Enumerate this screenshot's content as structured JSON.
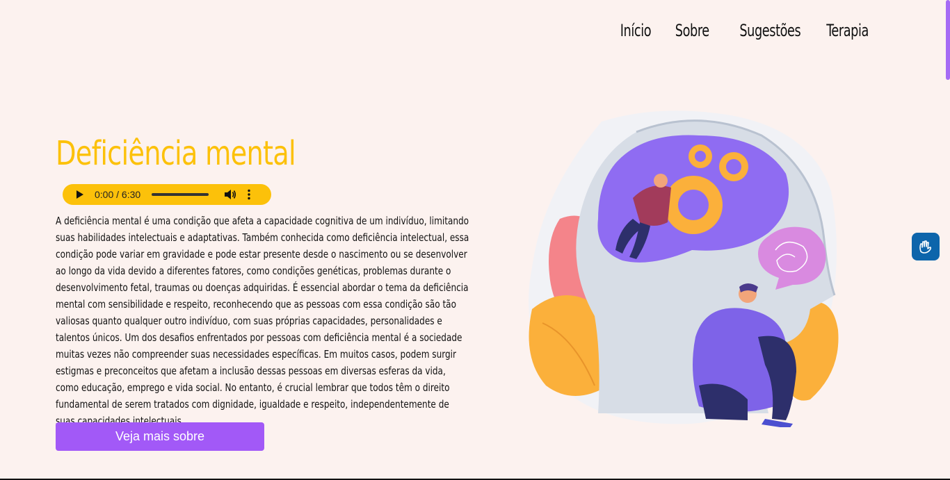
{
  "nav": {
    "items": [
      "Início",
      "Sobre",
      "Sugestões",
      "Terapia"
    ]
  },
  "hero": {
    "title": "Deficiência mental",
    "audio_time": "0:00 / 6:30",
    "description": "A deficiência mental é uma condição que afeta a capacidade cognitiva de um indivíduo, limitando suas habilidades intelectuais e adaptativas. Também conhecida como deficiência intelectual, essa condição pode variar em gravidade e pode estar presente desde o nascimento ou se desenvolver ao longo da vida devido a diferentes fatores, como condições genéticas, problemas durante o desenvolvimento fetal, traumas ou doenças adquiridas. É essencial abordar o tema da deficiência mental com sensibilidade e respeito, reconhecendo que as pessoas com essa condição são tão valiosas quanto qualquer outro indivíduo, com suas próprias capacidades, personalidades e talentos únicos. Um dos desafios enfrentados por pessoas com deficiência mental é a sociedade muitas vezes não compreender suas necessidades específicas. Em muitos casos, podem surgir estigmas e preconceitos que afetam a inclusão dessas pessoas em diversas esferas da vida, como educação, emprego e vida social. No entanto, é crucial lembrar que todos têm o direito fundamental de serem tratados com dignidade, igualdade e respeito, independentemente de suas capacidades intelectuais.",
    "cta_label": "Veja mais sobre"
  },
  "icons": {
    "play": "play-icon",
    "volume": "volume-icon",
    "more": "more-vert-icon",
    "accessibility": "sign-language-hands-icon"
  },
  "colors": {
    "background": "#fcf2ef",
    "accent_yellow": "#fcc10a",
    "accent_purple": "#a259f7",
    "vlibras_blue": "#0d65ab"
  }
}
